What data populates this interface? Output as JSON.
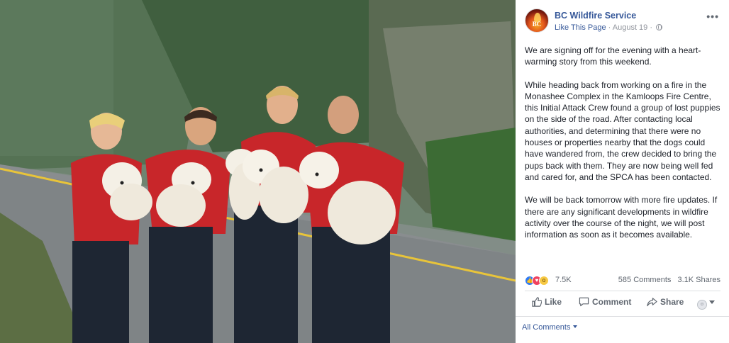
{
  "post": {
    "page_name": "BC Wildfire Service",
    "like_page": "Like This Page",
    "separator": " · ",
    "date": "August 19",
    "separator2": " · ",
    "paragraphs": [
      "We are signing off for the evening with a heart-warming story from this weekend.",
      "While heading back from working on a fire in the Monashee Complex in the Kamloops Fire Centre, this Initial Attack Crew found a group of lost puppies on the side of the road. After contacting local authorities, and determining that there were no houses or properties nearby that the dogs could have wandered from, the crew decided to bring the pups back with them. They are now being well fed and cared for, and the SPCA has been contacted.",
      "We will be back tomorrow with more fire updates. If there are any significant developments in wildfire activity over the course of the night, we will post information as soon as it becomes available."
    ],
    "avatar_text": "BC",
    "more_label": "•••"
  },
  "stats": {
    "reactions_count": "7.5K",
    "comments": "585 Comments",
    "shares": "3.1K Shares",
    "reaction_icons": [
      "like-reaction-icon",
      "love-reaction-icon",
      "wow-reaction-icon"
    ]
  },
  "actions": {
    "like": "Like",
    "comment": "Comment",
    "share": "Share"
  },
  "comments_filter": "All Comments",
  "colors": {
    "link": "#365899",
    "text": "#1d2129",
    "muted": "#606770",
    "like_blue": "#2e7bf6",
    "love_red": "#f0425f",
    "wow_yellow": "#f7c944"
  }
}
